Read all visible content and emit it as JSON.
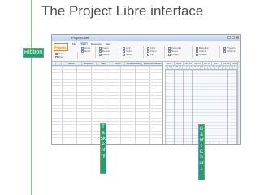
{
  "slide": {
    "title": "The Project Libre interface",
    "callouts": {
      "ribbon": "Ribbon",
      "task_entry": "Task entry",
      "gantt_chart": "Gantt Chart"
    }
  },
  "app": {
    "logo": "ProjectLibre",
    "title": "ProjectLibre",
    "ribbon_tabs": [
      "File",
      "Task",
      "Resource",
      "View"
    ],
    "ribbon_groups": [
      [
        "Save",
        "Print",
        "PDF"
      ],
      [
        "Undo",
        "Redo"
      ],
      [
        "Insert",
        "Delete",
        "Indent"
      ],
      [
        "Link",
        "Unlink",
        "Scroll"
      ],
      [
        "Find",
        "Zoom",
        "Fill"
      ],
      [
        "Calendar",
        "Notes",
        "Assign"
      ],
      [
        "Baseline",
        "Critical",
        "Update"
      ],
      [
        "Projects",
        "Options"
      ]
    ],
    "table_headers": [
      "",
      "",
      "Name",
      "Duration",
      "Start",
      "Finish",
      "Predecessors",
      "Resource Names"
    ],
    "gantt_weeks": [
      "Jan 1",
      "Jan 8",
      "Jan 15",
      "Jan 22",
      "Jan 29",
      "Feb 5",
      "Feb 12",
      "Feb 19"
    ],
    "gantt_days": [
      "S",
      "M",
      "T",
      "W",
      "T",
      "F",
      "S",
      "S",
      "M",
      "T",
      "W",
      "T",
      "F",
      "S",
      "S",
      "M",
      "T",
      "W",
      "T",
      "F",
      "S"
    ]
  },
  "colors": {
    "callout_green": "#2c9c63",
    "accent_line": "#8ec28b",
    "title_text": "#4c4c4c"
  }
}
